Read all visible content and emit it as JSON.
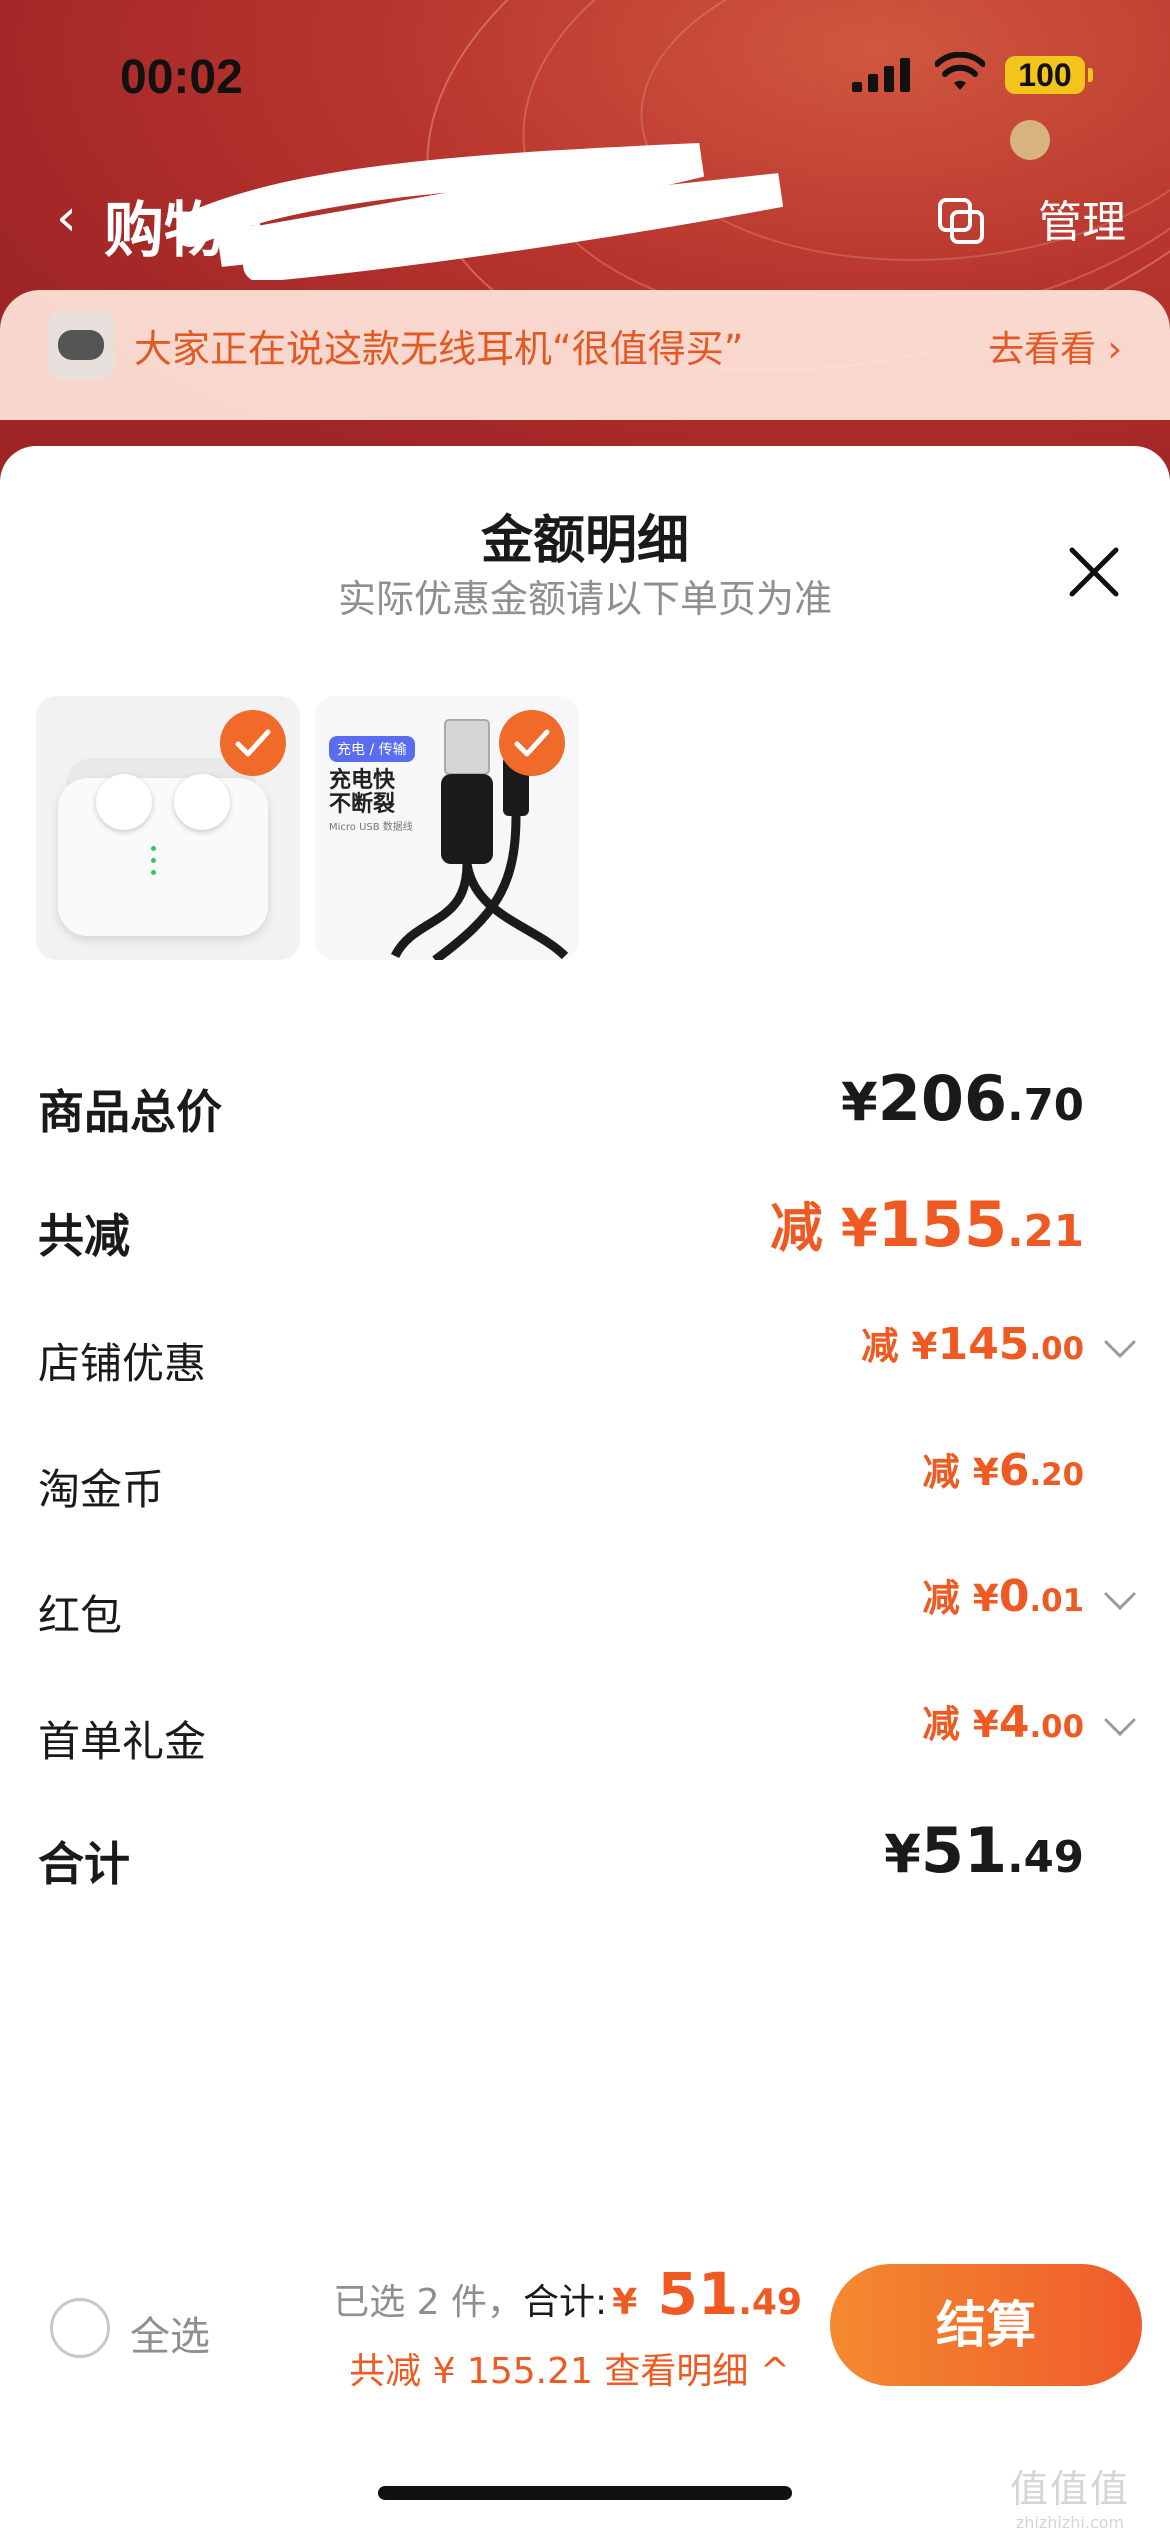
{
  "status_bar": {
    "time": "00:02",
    "battery": "100"
  },
  "nav": {
    "back_icon": "chevron-left",
    "title": "购物车",
    "manage": "管理"
  },
  "notice": {
    "text": "大家正在说这款无线耳机“很值得买”",
    "more": "去看看 ›"
  },
  "sheet": {
    "title": "金额明细",
    "subtitle": "实际优惠金额请以下单页为准",
    "products": [
      {
        "name": "wireless-earbuds",
        "checked": true
      },
      {
        "name": "micro-usb-cable",
        "checked": true,
        "tag": "充电 / 传输",
        "line1": "充电快",
        "line2": "不断裂",
        "line3": "Micro USB 数据线"
      }
    ],
    "rows": [
      {
        "label": "商品总价",
        "prefix": "",
        "yen": "¥",
        "int": "206",
        "dec": ".70",
        "color": "#1a1a1a",
        "chevron": false
      },
      {
        "label": "共减",
        "prefix": "减 ",
        "yen": "¥",
        "int": "155",
        "dec": ".21",
        "color": "#ee5a21",
        "chevron": false
      },
      {
        "label": "店铺优惠",
        "prefix": "减 ",
        "yen": "¥",
        "int": "145",
        "dec": ".00",
        "color": "#ee5a21",
        "chevron": true
      },
      {
        "label": "淘金币",
        "prefix": "减 ",
        "yen": "¥",
        "int": "6",
        "dec": ".20",
        "color": "#ee5a21",
        "chevron": false
      },
      {
        "label": "红包",
        "prefix": "减 ",
        "yen": "¥",
        "int": "0",
        "dec": ".01",
        "color": "#ee5a21",
        "chevron": true
      },
      {
        "label": "首单礼金",
        "prefix": "减 ",
        "yen": "¥",
        "int": "4",
        "dec": ".00",
        "color": "#ee5a21",
        "chevron": true
      },
      {
        "label": "合计",
        "prefix": "",
        "yen": "¥",
        "int": "51",
        "dec": ".49",
        "color": "#1a1a1a",
        "chevron": false
      }
    ]
  },
  "bottom_bar": {
    "select_all": "全选",
    "selected_text": "已选 2 件，",
    "total_label": "合计:",
    "total_yen": "¥",
    "total_int": "51",
    "total_dec": ".49",
    "discount_text": "共减 ¥ 155.21",
    "detail_link": "查看明细 ^",
    "checkout": "结算"
  },
  "watermark": {
    "line1": "值值值",
    "line2": "zhizhizhi.com"
  },
  "colors": {
    "accent": "#ee5a21",
    "header_red": "#b8352e"
  }
}
